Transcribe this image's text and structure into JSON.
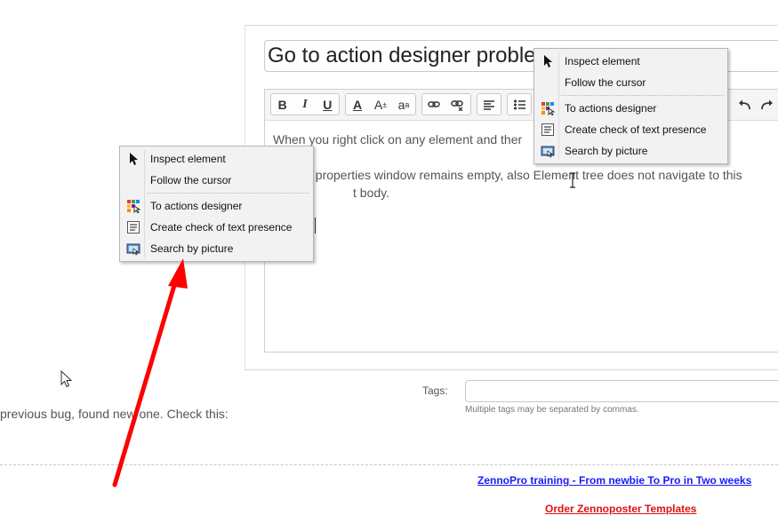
{
  "title_input": {
    "value": "Go to action designer proble"
  },
  "toolbar": {
    "bold": "B",
    "italic": "I",
    "underline": "U",
    "font_color": "A",
    "font_size": "A",
    "font_family": "a"
  },
  "editor": {
    "line1": "When you right click on any element and ther",
    "line2": "t properties window remains empty, also Element tree does not navigate to this",
    "line3": "t body."
  },
  "tags": {
    "label": "Tags:",
    "hint": "Multiple tags may be separated by commas.",
    "value": ""
  },
  "left_text": "previous bug, found new one. Check this:",
  "links": {
    "training": "ZennoPro training - From newbie To Pro in Two weeks",
    "templates": "Order Zennoposter Templates"
  },
  "context_menu": {
    "inspect": "Inspect element",
    "follow": "Follow the cursor",
    "designer": "To actions designer",
    "check_text": "Create check of text presence",
    "search_picture": "Search by picture"
  },
  "colors": {
    "arrow": "#ff0000",
    "link_blue": "#1a1aff",
    "link_red": "#e01010"
  }
}
